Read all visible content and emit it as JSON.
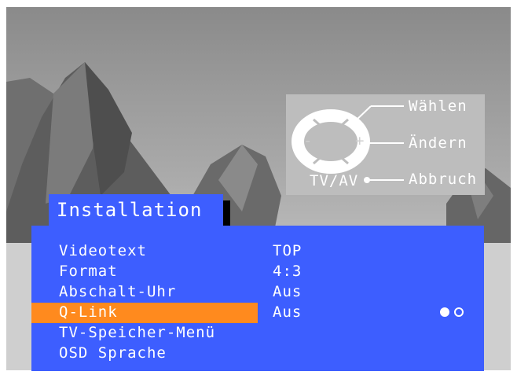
{
  "help": {
    "waehlen": "Wählen",
    "aendern": "Ändern",
    "abbruch": "Abbruch",
    "tvav": "TV/AV",
    "up": "^",
    "down": "v",
    "minus": "-",
    "plus": "+"
  },
  "menu": {
    "title": "Installation",
    "items": [
      {
        "label": "Videotext",
        "value": "TOP"
      },
      {
        "label": "Format",
        "value": "4:3"
      },
      {
        "label": "Abschalt-Uhr",
        "value": "Aus"
      },
      {
        "label": "Q-Link",
        "value": "Aus",
        "selected": true
      },
      {
        "label": "TV-Speicher-Menü",
        "value": ""
      },
      {
        "label": "OSD Sprache",
        "value": ""
      }
    ],
    "page_indicator": {
      "current": 1,
      "total": 2
    }
  },
  "colors": {
    "panel": "#3d5eff",
    "highlight": "#ff8a1e",
    "text": "#ffffff",
    "help_box": "#bdbdbd"
  }
}
